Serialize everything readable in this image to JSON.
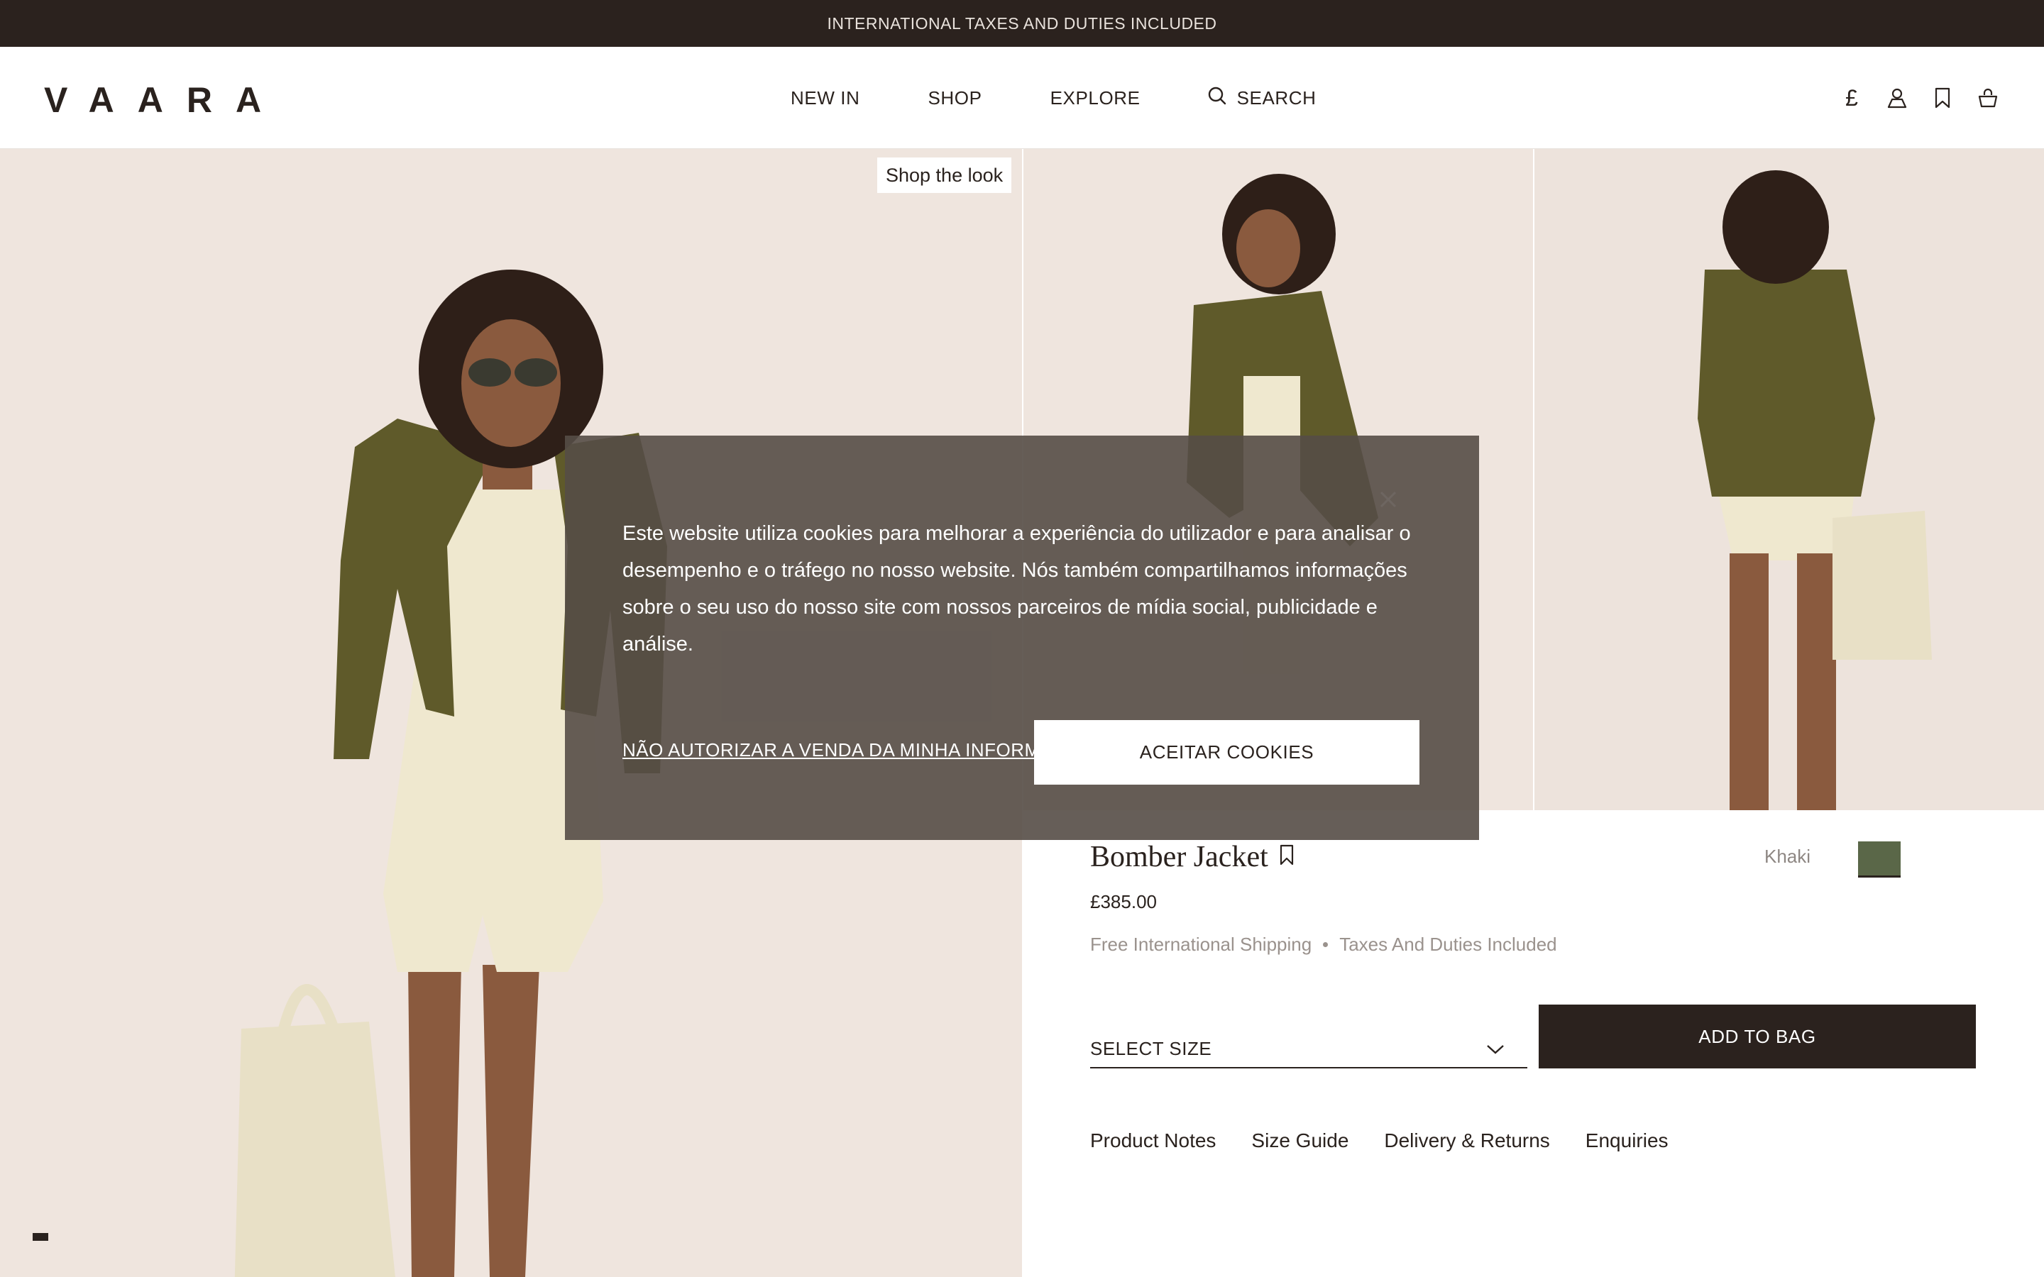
{
  "announcement": "INTERNATIONAL TAXES AND DUTIES INCLUDED",
  "header": {
    "logo": "VAARA",
    "nav": {
      "new_in": "NEW IN",
      "shop": "SHOP",
      "explore": "EXPLORE",
      "search": "SEARCH"
    },
    "icons": [
      "currency-pound-icon",
      "account-icon",
      "bookmark-icon",
      "shopping-bag-icon"
    ],
    "currency_symbol": "£"
  },
  "gallery": {
    "shop_the_look": "Shop the look",
    "background_color": "#efe5de"
  },
  "product": {
    "title": "Bomber Jacket",
    "price": "£385.00",
    "shipping": "Free International Shipping",
    "taxes": "Taxes And Duties Included",
    "color_name": "Khaki",
    "color_hex": "#5a6748",
    "select_size": "SELECT SIZE",
    "add_to_bag": "ADD TO BAG",
    "tabs": [
      "Product Notes",
      "Size Guide",
      "Delivery & Returns",
      "Enquiries"
    ]
  },
  "cookie_banner": {
    "text": "Este website utiliza cookies para melhorar a experiência do utilizador e para analisar o desempenho e o tráfego no nosso website. Nós também compartilhamos informações sobre o seu uso do nosso site com nossos parceiros de mídia social, publicidade e análise.",
    "opt_out": "NÃO AUTORIZAR A VENDA DA MINHA INFORMAÇÃO PESSOAL",
    "accept": "ACEITAR COOKIES"
  },
  "colors": {
    "dark": "#2b221e",
    "muted_text": "#9a928d",
    "cookie_bg": "#554c46"
  }
}
